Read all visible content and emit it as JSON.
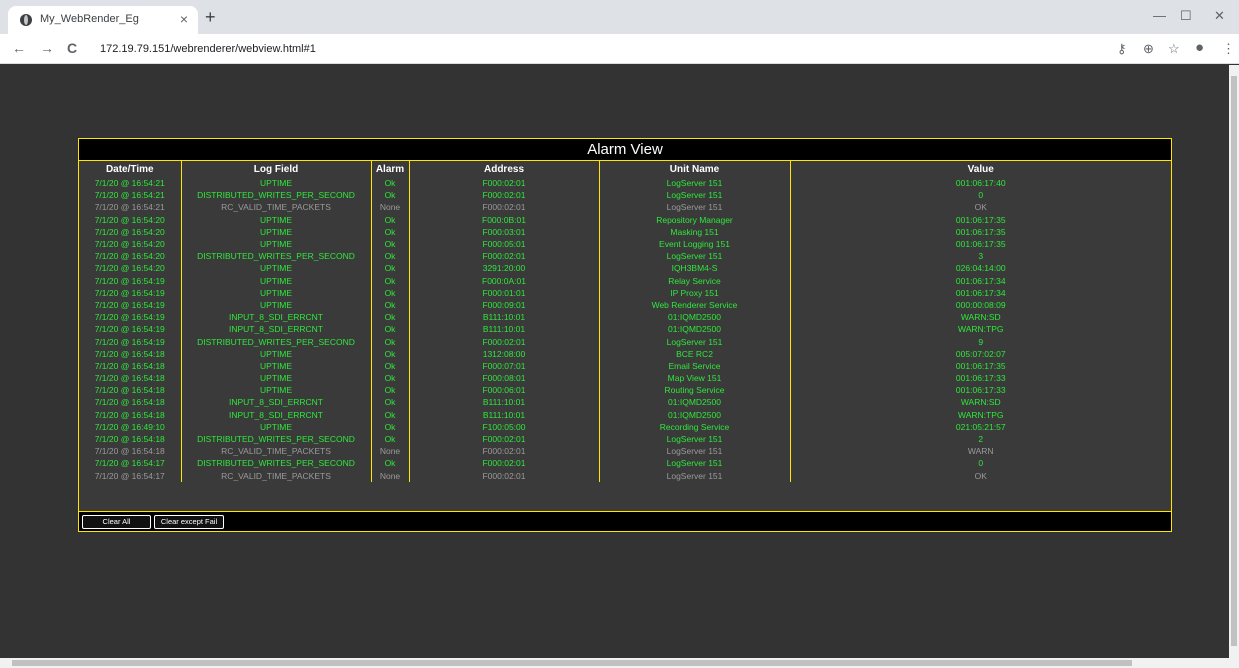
{
  "browser": {
    "tab_title": "My_WebRender_Eg",
    "tab_close": "×",
    "new_tab": "+",
    "url": "172.19.79.151/webrenderer/webview.html#1",
    "back": "←",
    "forward": "→",
    "reload": "C",
    "window_minimize": "—",
    "window_maximize": "☐",
    "window_close": "✕",
    "icon_key": "⚷",
    "icon_zoom": "⊕",
    "icon_star": "☆",
    "icon_account": "●",
    "icon_menu": "⋮"
  },
  "alarm_view": {
    "title": "Alarm View",
    "columns": [
      "Date/Time",
      "Log Field",
      "Alarm",
      "Address",
      "Unit Name",
      "Value"
    ],
    "rows": [
      {
        "status": "ok",
        "date": "7/1/20 @ 16:54:21",
        "field": "UPTIME",
        "alarm": "Ok",
        "address": "F000:02:01",
        "unit": "LogServer 151",
        "value": "001:06:17:40"
      },
      {
        "status": "ok",
        "date": "7/1/20 @ 16:54:21",
        "field": "DISTRIBUTED_WRITES_PER_SECOND",
        "alarm": "Ok",
        "address": "F000:02:01",
        "unit": "LogServer 151",
        "value": "0"
      },
      {
        "status": "none",
        "date": "7/1/20 @ 16:54:21",
        "field": "RC_VALID_TIME_PACKETS",
        "alarm": "None",
        "address": "F000:02:01",
        "unit": "LogServer 151",
        "value": "OK"
      },
      {
        "status": "ok",
        "date": "7/1/20 @ 16:54:20",
        "field": "UPTIME",
        "alarm": "Ok",
        "address": "F000:0B:01",
        "unit": "Repository Manager",
        "value": "001:06:17:35"
      },
      {
        "status": "ok",
        "date": "7/1/20 @ 16:54:20",
        "field": "UPTIME",
        "alarm": "Ok",
        "address": "F000:03:01",
        "unit": "Masking 151",
        "value": "001:06:17:35"
      },
      {
        "status": "ok",
        "date": "7/1/20 @ 16:54:20",
        "field": "UPTIME",
        "alarm": "Ok",
        "address": "F000:05:01",
        "unit": "Event Logging 151",
        "value": "001:06:17:35"
      },
      {
        "status": "ok",
        "date": "7/1/20 @ 16:54:20",
        "field": "DISTRIBUTED_WRITES_PER_SECOND",
        "alarm": "Ok",
        "address": "F000:02:01",
        "unit": "LogServer 151",
        "value": "3"
      },
      {
        "status": "ok",
        "date": "7/1/20 @ 16:54:20",
        "field": "UPTIME",
        "alarm": "Ok",
        "address": "3291:20:00",
        "unit": "IQH3BM4-S",
        "value": "026:04:14:00"
      },
      {
        "status": "ok",
        "date": "7/1/20 @ 16:54:19",
        "field": "UPTIME",
        "alarm": "Ok",
        "address": "F000:0A:01",
        "unit": "Relay Service",
        "value": "001:06:17:34"
      },
      {
        "status": "ok",
        "date": "7/1/20 @ 16:54:19",
        "field": "UPTIME",
        "alarm": "Ok",
        "address": "F000:01:01",
        "unit": "IP Proxy 151",
        "value": "001:06:17:34"
      },
      {
        "status": "ok",
        "date": "7/1/20 @ 16:54:19",
        "field": "UPTIME",
        "alarm": "Ok",
        "address": "F000:09:01",
        "unit": "Web Renderer Service",
        "value": "000:00:08:09"
      },
      {
        "status": "ok",
        "date": "7/1/20 @ 16:54:19",
        "field": "INPUT_8_SDI_ERRCNT",
        "alarm": "Ok",
        "address": "B111:10:01",
        "unit": "01:IQMD2500",
        "value": "WARN:SD"
      },
      {
        "status": "ok",
        "date": "7/1/20 @ 16:54:19",
        "field": "INPUT_8_SDI_ERRCNT",
        "alarm": "Ok",
        "address": "B111:10:01",
        "unit": "01:IQMD2500",
        "value": "WARN:TPG"
      },
      {
        "status": "ok",
        "date": "7/1/20 @ 16:54:19",
        "field": "DISTRIBUTED_WRITES_PER_SECOND",
        "alarm": "Ok",
        "address": "F000:02:01",
        "unit": "LogServer 151",
        "value": "9"
      },
      {
        "status": "ok",
        "date": "7/1/20 @ 16:54:18",
        "field": "UPTIME",
        "alarm": "Ok",
        "address": "1312:08:00",
        "unit": "BCE RC2",
        "value": "005:07:02:07"
      },
      {
        "status": "ok",
        "date": "7/1/20 @ 16:54:18",
        "field": "UPTIME",
        "alarm": "Ok",
        "address": "F000:07:01",
        "unit": "Email Service",
        "value": "001:06:17:35"
      },
      {
        "status": "ok",
        "date": "7/1/20 @ 16:54:18",
        "field": "UPTIME",
        "alarm": "Ok",
        "address": "F000:08:01",
        "unit": "Map View 151",
        "value": "001:06:17:33"
      },
      {
        "status": "ok",
        "date": "7/1/20 @ 16:54:18",
        "field": "UPTIME",
        "alarm": "Ok",
        "address": "F000:06:01",
        "unit": "Routing Service",
        "value": "001:06:17:33"
      },
      {
        "status": "ok",
        "date": "7/1/20 @ 16:54:18",
        "field": "INPUT_8_SDI_ERRCNT",
        "alarm": "Ok",
        "address": "B111:10:01",
        "unit": "01:IQMD2500",
        "value": "WARN:SD"
      },
      {
        "status": "ok",
        "date": "7/1/20 @ 16:54:18",
        "field": "INPUT_8_SDI_ERRCNT",
        "alarm": "Ok",
        "address": "B111:10:01",
        "unit": "01:IQMD2500",
        "value": "WARN:TPG"
      },
      {
        "status": "ok",
        "date": "7/1/20 @ 16:49:10",
        "field": "UPTIME",
        "alarm": "Ok",
        "address": "F100:05:00",
        "unit": "Recording Service",
        "value": "021:05:21:57"
      },
      {
        "status": "ok",
        "date": "7/1/20 @ 16:54:18",
        "field": "DISTRIBUTED_WRITES_PER_SECOND",
        "alarm": "Ok",
        "address": "F000:02:01",
        "unit": "LogServer 151",
        "value": "2"
      },
      {
        "status": "none",
        "date": "7/1/20 @ 16:54:18",
        "field": "RC_VALID_TIME_PACKETS",
        "alarm": "None",
        "address": "F000:02:01",
        "unit": "LogServer 151",
        "value": "WARN"
      },
      {
        "status": "ok",
        "date": "7/1/20 @ 16:54:17",
        "field": "DISTRIBUTED_WRITES_PER_SECOND",
        "alarm": "Ok",
        "address": "F000:02:01",
        "unit": "LogServer 151",
        "value": "0"
      },
      {
        "status": "none",
        "date": "7/1/20 @ 16:54:17",
        "field": "RC_VALID_TIME_PACKETS",
        "alarm": "None",
        "address": "F000:02:01",
        "unit": "LogServer 151",
        "value": "OK"
      }
    ],
    "buttons": {
      "clear_all": "Clear All",
      "clear_except_fail": "Clear except Fail"
    }
  },
  "colors": {
    "page_background": "#333333",
    "panel_border": "#ffe600",
    "ok_text": "#2ee83a",
    "none_text": "#9a9a9a"
  }
}
